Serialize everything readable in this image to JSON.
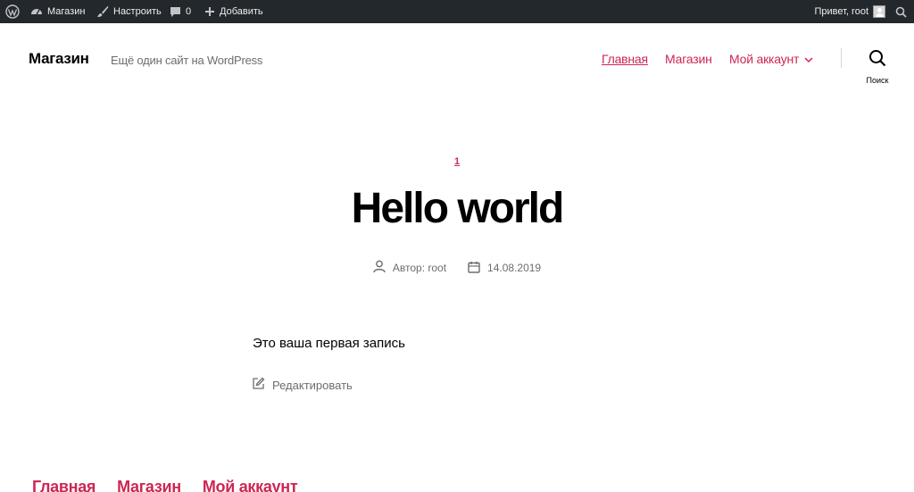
{
  "adminbar": {
    "wp_icon": "wordpress-logo-icon",
    "site_name": "Магазин",
    "site_icon": "dashboard-icon",
    "customize": "Настроить",
    "customize_icon": "brush-icon",
    "comments_count": "0",
    "comments_icon": "comment-bubble-icon",
    "new_label": "Добавить",
    "new_icon": "plus-icon",
    "greeting": "Привет, root",
    "avatar_icon": "user-avatar-icon",
    "search_icon": "search-icon",
    "bg_color": "#23282d"
  },
  "header": {
    "site_title": "Магазин",
    "site_description": "Ещё один сайт на WordPress",
    "menu": [
      "Главная",
      "Магазин",
      "Мой аккаунт"
    ],
    "submenu_icon": "chevron-down-icon",
    "search_label": "Поиск",
    "search_icon": "search-icon",
    "accent_color": "#cd2653"
  },
  "post": {
    "category": "1",
    "title": "Hello world",
    "author": "Автор: root",
    "author_icon": "user-icon",
    "date": "14.08.2019",
    "date_icon": "calendar-icon",
    "content": "Это ваша первая запись",
    "edit_label": "Редактировать",
    "edit_icon": "edit-icon"
  },
  "footer": {
    "menu": [
      "Главная",
      "Магазин",
      "Мой аккаунт"
    ]
  }
}
